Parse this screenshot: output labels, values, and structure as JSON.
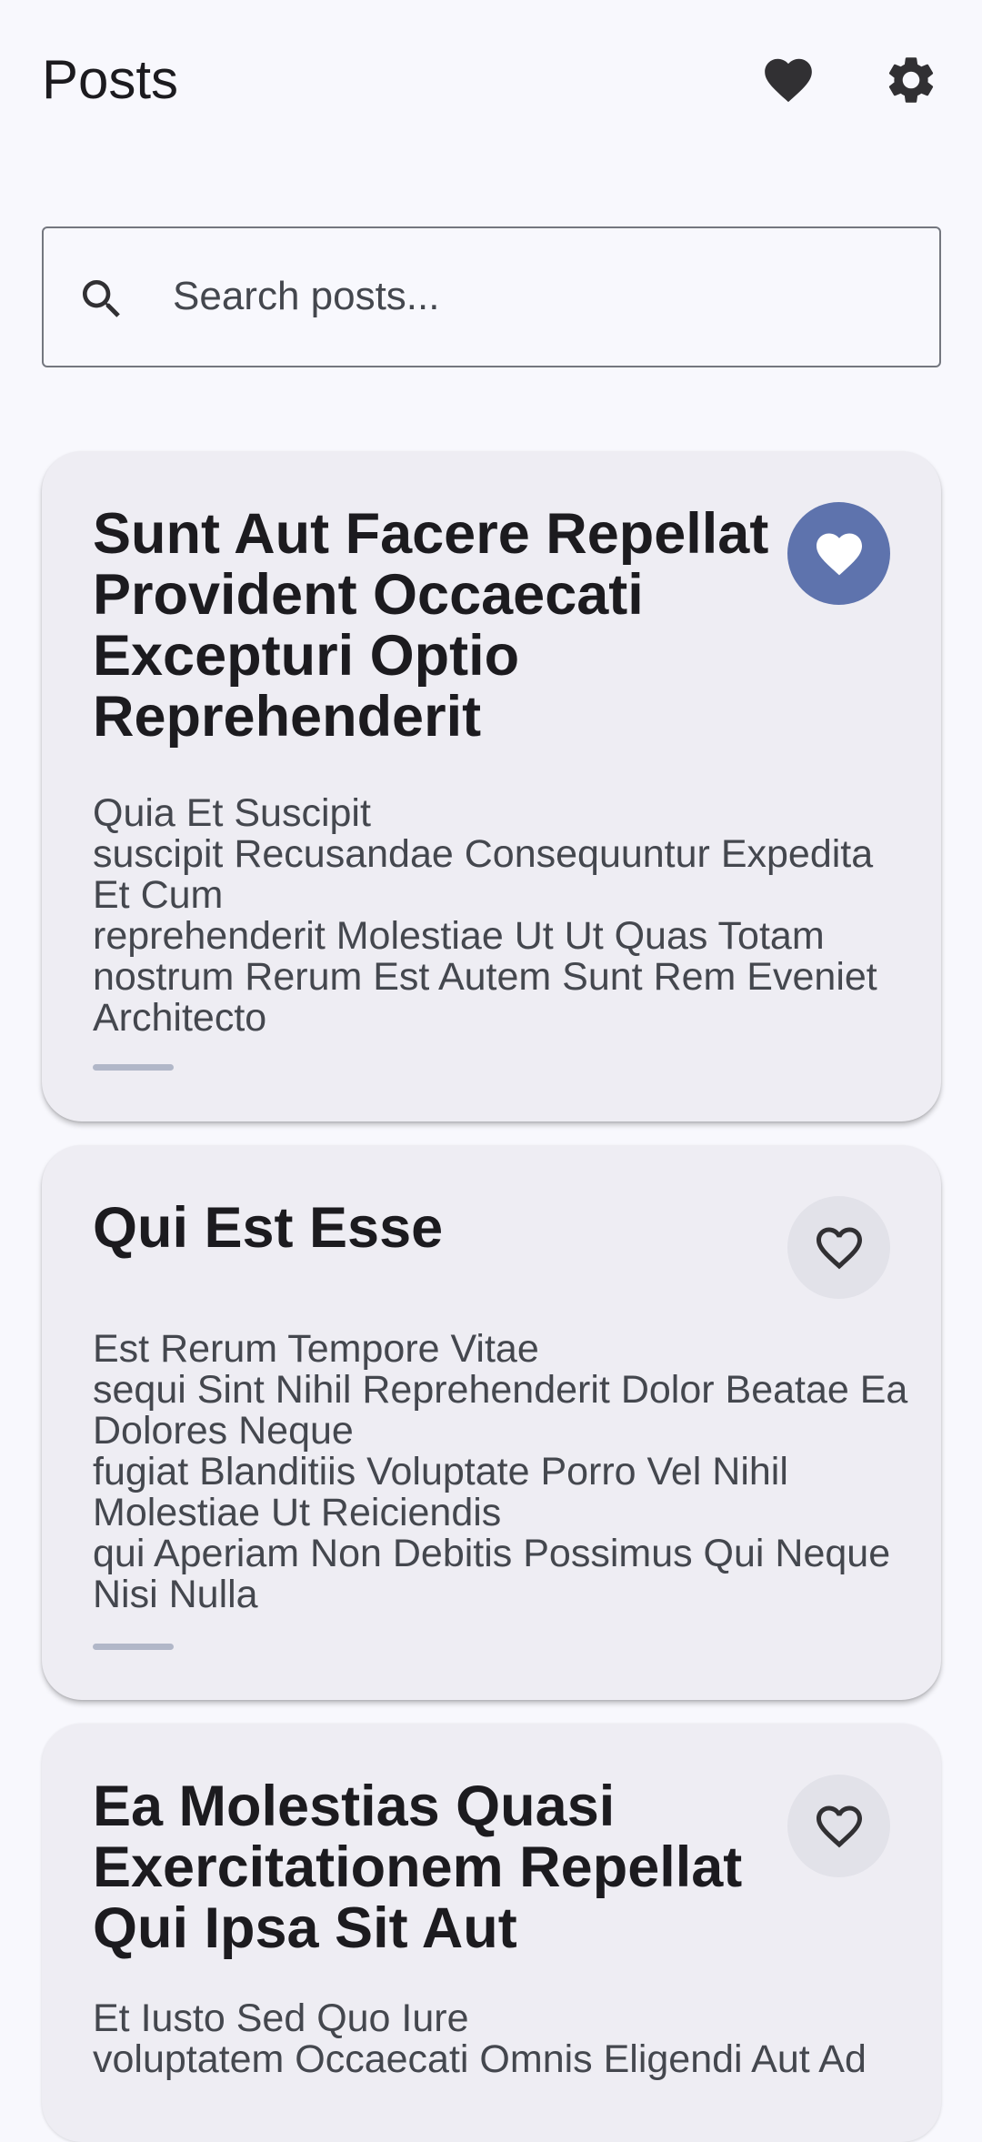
{
  "app_bar": {
    "title": "Posts",
    "favorites_icon": "heart-filled-icon",
    "settings_icon": "gear-icon"
  },
  "search": {
    "icon": "search-icon",
    "placeholder": "Search posts...",
    "value": ""
  },
  "colors": {
    "background": "#f8f8fd",
    "card": "#eeedf3",
    "favorite_active": "#5e73ad",
    "favorite_inactive": "#e2e2e9"
  },
  "posts": [
    {
      "title": "Sunt Aut Facere Repellat Provident Occaecati Excepturi Optio Reprehenderit",
      "body": "Quia Et Suscipit\nsuscipit Recusandae Consequuntur Expedita Et Cum\nreprehenderit Molestiae Ut Ut Quas Totam\nnostrum Rerum Est Autem Sunt Rem Eveniet Architecto",
      "favorited": true
    },
    {
      "title": "Qui Est Esse",
      "body": "Est Rerum Tempore Vitae\nsequi Sint Nihil Reprehenderit Dolor Beatae Ea Dolores Neque\nfugiat Blanditiis Voluptate Porro Vel Nihil Molestiae Ut Reiciendis\nqui Aperiam Non Debitis Possimus Qui Neque Nisi Nulla",
      "favorited": false
    },
    {
      "title": "Ea Molestias Quasi Exercitationem Repellat Qui Ipsa Sit Aut",
      "body": "Et Iusto Sed Quo Iure\nvoluptatem Occaecati Omnis Eligendi Aut Ad",
      "favorited": false
    }
  ]
}
